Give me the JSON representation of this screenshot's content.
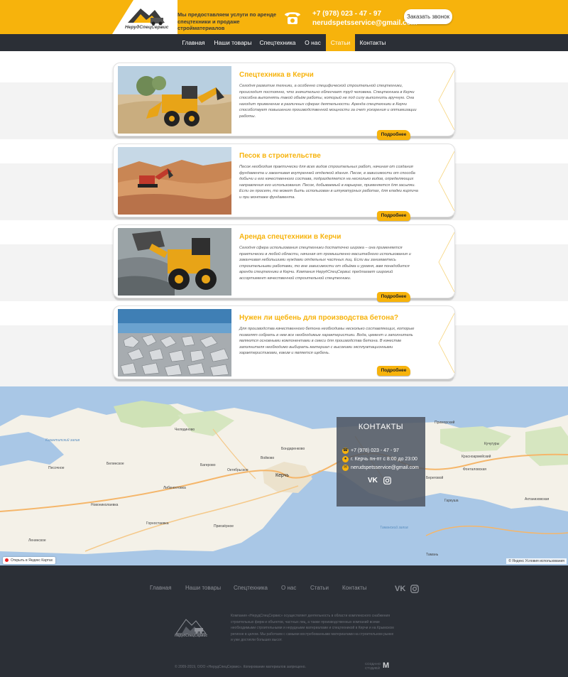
{
  "brand": {
    "logo_text": "НерудСпецСервис",
    "tagline": "Мы предоставляем услуги по аренде спецтехники и продаже стройматериалов",
    "accent_color": "#f7b30c",
    "dark_color": "#2b2f36"
  },
  "header": {
    "phone": "+7 (978) 023 - 47 - 97",
    "email": "nerudspetsservice@gmail.com",
    "call_button": "Заказать звонок"
  },
  "nav": {
    "items": [
      {
        "label": "Главная"
      },
      {
        "label": "Наши товары"
      },
      {
        "label": "Спецтехника"
      },
      {
        "label": "О нас"
      },
      {
        "label": "Статьи"
      },
      {
        "label": "Контакты"
      }
    ],
    "active": "Статьи"
  },
  "articles": [
    {
      "title": "Спецтехника в Керчи",
      "text": "Сегодня развитие техники, а особенно специфической строительной спецтехники, происходит постоянно, что значительно облегчает труд человека. Спецтехника в Керчи способна выполнять такой объём работы, который не под силу выполнить вручную. Она находит применение в различных сферах деятельности. Аренда спецтехники в Керчи способствует повышению производственной мощности за счет ускорения и оптимизации работы.",
      "more": "Подробнее",
      "image": "backhoe-loader-photo"
    },
    {
      "title": "Песок в строительстве",
      "text": "Песок необходим практически для всех видов строительных работ, начиная от создания фундамента и заканчивая внутренней отделкой здания. Песок, в зависимости от способа добычи и его качественного состава, подразделяется на несколько видов, определяющих направления его использования. Песок, добываемый в карьерах, применяется для засыпки. Если он просеян, то может быть использован в штукатурных работах, для кладки кирпича и при монтаже фундамента.",
      "more": "Подробнее",
      "image": "sand-quarry-excavator-photo"
    },
    {
      "title": "Аренда спецтехники в Керчи",
      "text": "Сегодня сфера использования спецтехники достаточно широка – она применяется практически в любой области, начиная от промышленно масштабного использования и заканчивая небольшими нуждами отдельных частных лиц. Если вы занимаетесь строительными работами, то вне зависимости от объёма и уровня, вам понадобится аренда спецтехники в Керчи. Компания НерудСпецСервис предлагает широкий ассортимент качественной строительной спецтехники.",
      "more": "Подробнее",
      "image": "wheel-loader-gravel-photo"
    },
    {
      "title": "Нужен ли щебень для производства бетона?",
      "text": "Для производства качественного бетона необходимы несколько составляющих, которые позволят собрать в нем все необходимые характеристики. Вода, цемент и заполнитель являются основными компонентами в смеси для производства бетона. В качестве заполнителя необходимо выбирать материал с высокими эксплуатационными характеристиками, каким и является щебень.",
      "more": "Подробнее",
      "image": "crushed-stone-photo"
    }
  ],
  "map": {
    "labels": [
      {
        "text": "Керчь",
        "cls": "big"
      },
      {
        "text": "Багерово",
        "cls": ""
      },
      {
        "text": "Войково",
        "cls": ""
      },
      {
        "text": "Горностаевка",
        "cls": ""
      },
      {
        "text": "Приозёрное",
        "cls": ""
      },
      {
        "text": "Ленинское",
        "cls": ""
      },
      {
        "text": "Октябрьское",
        "cls": ""
      },
      {
        "text": "Либкнехтовка",
        "cls": ""
      },
      {
        "text": "Бондаренково",
        "cls": ""
      },
      {
        "text": "Кучугуры",
        "cls": ""
      },
      {
        "text": "Ахтанизовская",
        "cls": ""
      },
      {
        "text": "Тамань",
        "cls": ""
      },
      {
        "text": "Приморский",
        "cls": ""
      },
      {
        "text": "Новониколаевка",
        "cls": ""
      },
      {
        "text": "Песочное",
        "cls": ""
      },
      {
        "text": "Челядиново",
        "cls": ""
      },
      {
        "text": "Казантипский залив",
        "cls": "water"
      },
      {
        "text": "Таманский залив",
        "cls": "water"
      },
      {
        "text": "Белинское",
        "cls": ""
      },
      {
        "text": "Гаркуша",
        "cls": ""
      },
      {
        "text": "Береговой",
        "cls": ""
      },
      {
        "text": "Красноармейский",
        "cls": ""
      },
      {
        "text": "Фонталовская",
        "cls": ""
      }
    ],
    "open_link": "Открыть в Яндекс Картах",
    "copyright": "© Яндекс Условия использования"
  },
  "contacts": {
    "title": "КОНТАКТЫ",
    "phone": "+7 (978) 023 - 47 - 97",
    "address": "г. Керчь  пн-пт  с 8:00 до 23:00",
    "email": "nerudspetsservice@gmail.com",
    "vk": "VK"
  },
  "footer": {
    "links": [
      {
        "label": "Главная"
      },
      {
        "label": "Наши товары"
      },
      {
        "label": "Спецтехника"
      },
      {
        "label": "О нас"
      },
      {
        "label": "Статьи"
      },
      {
        "label": "Контакты"
      }
    ],
    "vk": "VK",
    "logo_text": "НерудСпецСервис",
    "about": "Компания «НерудСпецСервис» осуществляет деятельность в области комплексного снабжения строительных фирм и объектов, частных лиц, а также производственных компаний всеми необходимыми строительными и нерудными материалами и спецтехникой в Керчи и на Крымском регионе в целом. Мы работаем с самыми востребованными материалами на строительном рынке и уже достигли больших высот.",
    "copyright": "© 2009-2019, ООО «НерудСпецСервис». Копирование материалов запрещено.",
    "studio_line1": "СОЗДАНО",
    "studio_line2": "СТУДИЕЙ",
    "studio_mark": "M"
  }
}
